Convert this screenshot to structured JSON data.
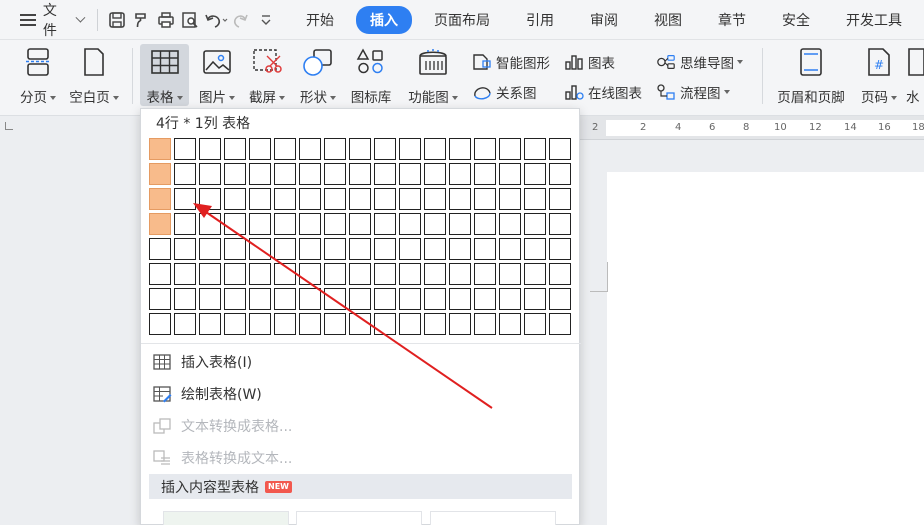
{
  "menubar": {
    "file_label": "文件",
    "tabs": [
      {
        "label": "开始",
        "active": false
      },
      {
        "label": "插入",
        "active": true
      },
      {
        "label": "页面布局",
        "active": false
      },
      {
        "label": "引用",
        "active": false
      },
      {
        "label": "审阅",
        "active": false
      },
      {
        "label": "视图",
        "active": false
      },
      {
        "label": "章节",
        "active": false
      },
      {
        "label": "安全",
        "active": false
      },
      {
        "label": "开发工具",
        "active": false
      }
    ]
  },
  "ribbon": {
    "page_break": "分页",
    "blank_page": "空白页",
    "table": "表格",
    "picture": "图片",
    "screenshot": "截屏",
    "shapes": "形状",
    "icon_library": "图标库",
    "function_chart": "功能图",
    "smart_art": "智能图形",
    "chart": "图表",
    "mind_map": "思维导图",
    "relation_chart": "关系图",
    "online_chart": "在线图表",
    "flow_chart": "流程图",
    "header_footer": "页眉和页脚",
    "page_number": "页码",
    "watermark": "水"
  },
  "ruler": {
    "ticks": [
      "2",
      "2",
      "4",
      "6",
      "8",
      "10",
      "12",
      "14",
      "16",
      "18"
    ]
  },
  "table_dropdown": {
    "title": "4行 * 1列 表格",
    "grid": {
      "cols": 17,
      "rows": 8,
      "selected_rows": 4,
      "selected_cols": 1
    },
    "highlight_color": "#f8bb8b",
    "items": [
      {
        "label": "插入表格(I)",
        "enabled": true
      },
      {
        "label": "绘制表格(W)",
        "enabled": true
      },
      {
        "label": "文本转换成表格...",
        "enabled": false
      },
      {
        "label": "表格转换成文本...",
        "enabled": false
      }
    ],
    "content_table": "插入内容型表格",
    "new_badge": "NEW"
  },
  "colors": {
    "accent": "#2e7ff2",
    "annotation_arrow": "#e02020",
    "new_badge": "#f2584e"
  }
}
